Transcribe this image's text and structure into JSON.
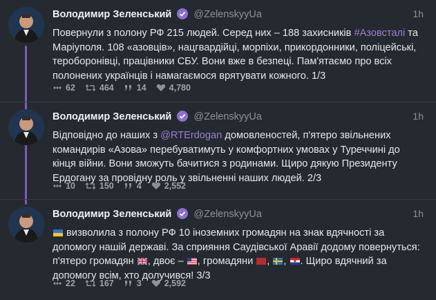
{
  "author": {
    "name": "Володимир Зеленський",
    "handle": "@ZelenskyyUa"
  },
  "tweets": [
    {
      "time": "1h",
      "text_a": "Повернули з полону РФ 215 людей. Серед них – 188 захисників ",
      "hashtag": "#Азовсталі",
      "text_b": " та Маріуполя. 108 «азовців», нацгвардійці, морпіхи, прикордонники, поліцейські, тероборонівці, працівники СБУ. Вони вже в безпеці. Пам'ятаємо про всіх полонених українців і намагаємося врятувати кожного. 1/3",
      "replies": "62",
      "retweets": "464",
      "quotes": "14",
      "likes": "4,780"
    },
    {
      "time": "1h",
      "text_a": "Відповідно до наших з ",
      "mention": "@RTErdogan",
      "text_b": " домовленостей, п'ятеро звільнених командирів «Азова» перебуватимуть у комфортних умовах у Туреччині до кінця війни. Вони зможуть бачитися з родинами. Щиро дякую Президенту Ердогану за провідну роль у звільненні наших людей. 2/3",
      "replies": "10",
      "retweets": "150",
      "quotes": "4",
      "likes": "2,552"
    },
    {
      "time": "1h",
      "text_a": " визволила з полону РФ 10 іноземних громадян на знак вдячності за допомогу нашій державі. За сприяння Саудівської Аравії додому повернуться: п'ятеро громадян ",
      "text_b": ", двоє – ",
      "text_c": ", громадяни ",
      "text_d": ". Щиро вдячний за допомогу всім, хто долучився! 3/3",
      "replies": "22",
      "retweets": "167",
      "quotes": "3",
      "likes": "2,592"
    }
  ],
  "colors": {
    "background": "#252a30",
    "accent": "#9b7fd6",
    "thread_line": "#7d5bbf",
    "muted": "#8a939c"
  },
  "icons": [
    "verified-badge-icon",
    "reply-icon",
    "retweet-icon",
    "quote-icon",
    "like-icon"
  ]
}
